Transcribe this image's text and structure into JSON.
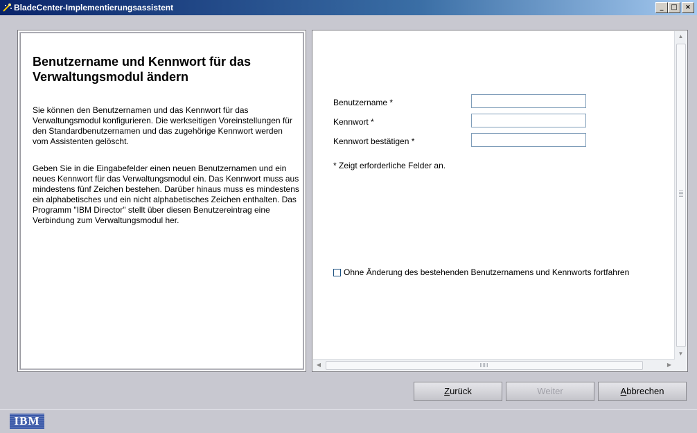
{
  "window": {
    "title": "BladeCenter-Implementierungsassistent",
    "controls": {
      "minimize": "_",
      "maximize": "□",
      "close": "×"
    }
  },
  "left_panel": {
    "title": "Benutzername und Kennwort für das Verwaltungsmodul ändern",
    "paragraph1": "Sie können den Benutzernamen und das Kennwort für das Verwaltungsmodul konfigurieren. Die werkseitigen Voreinstellungen für den Standardbenutzernamen und das zugehörige Kennwort werden vom Assistenten gelöscht.",
    "paragraph2": "Geben Sie in die Eingabefelder einen neuen Benutzernamen und ein neues Kennwort für das Verwaltungsmodul ein. Das Kennwort muss aus mindestens fünf Zeichen bestehen. Darüber hinaus muss es mindestens ein alphabetisches und ein nicht alphabetisches Zeichen enthalten. Das Programm \"IBM Director\" stellt über diesen Benutzereintrag eine Verbindung zum Verwaltungsmodul her."
  },
  "form": {
    "username_label": "Benutzername  *",
    "username_value": "",
    "password_label": "Kennwort  *",
    "password_value": "",
    "confirm_label": "Kennwort bestätigen  *",
    "confirm_value": "",
    "required_note": "* Zeigt erforderliche Felder an.",
    "continue_checkbox_label": "Ohne Änderung des bestehenden Benutzernamens und Kennworts fortfahren",
    "continue_checked": false
  },
  "buttons": {
    "back_mnemonic": "Z",
    "back_rest": "urück",
    "next_label": "Weiter",
    "cancel_mnemonic": "A",
    "cancel_rest": "bbrechen"
  },
  "footer": {
    "logo_text": "IBM"
  },
  "colors": {
    "titlebar": "#0a246a",
    "background": "#c8c8d0",
    "logo": "#3a58a8"
  }
}
